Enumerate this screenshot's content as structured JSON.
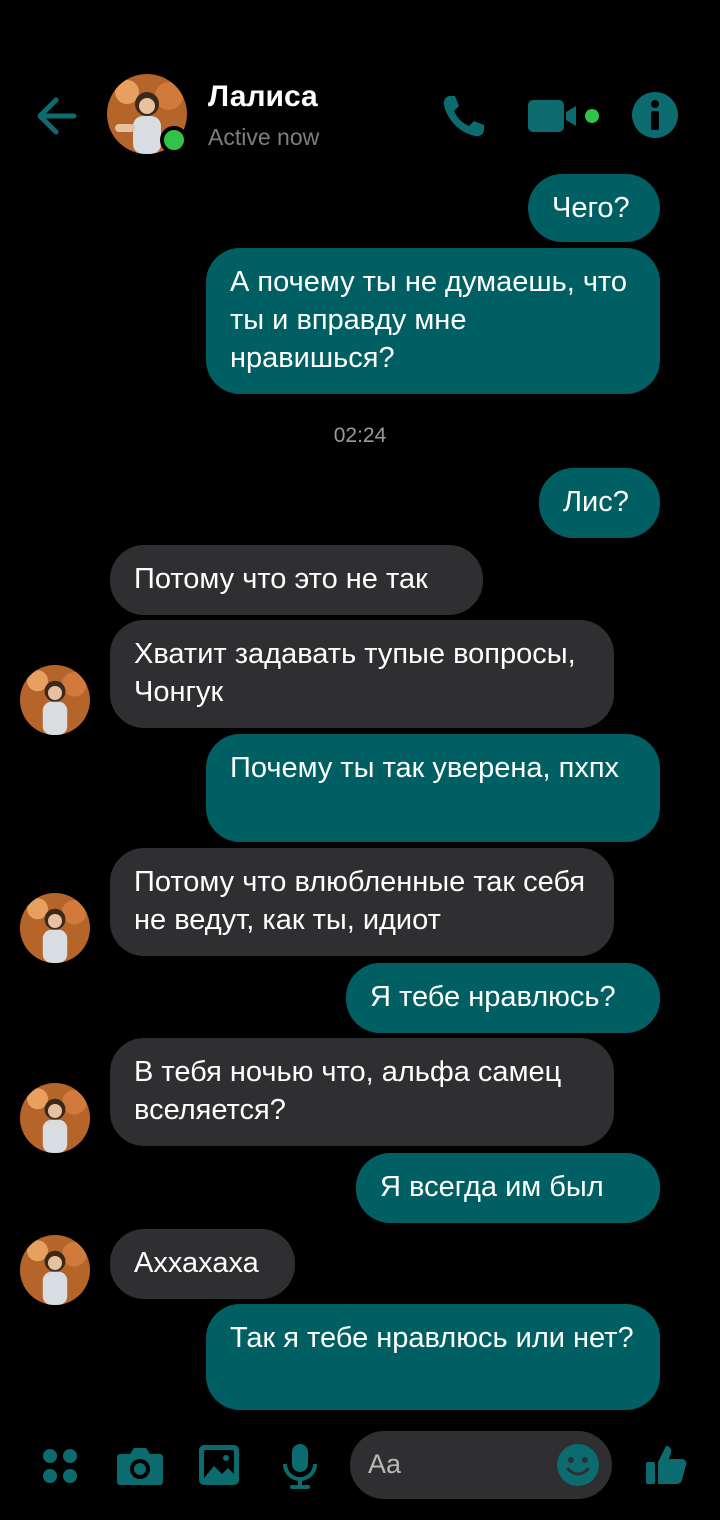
{
  "header": {
    "contact_name": "Лалиса",
    "status": "Active now",
    "icons": [
      "back-arrow-icon",
      "avatar",
      "phone-icon",
      "video-icon",
      "info-icon"
    ]
  },
  "timestamp": "02:24",
  "messages": [
    {
      "dir": "out",
      "text": "Чего?"
    },
    {
      "dir": "out",
      "text": "А почему ты не думаешь, что ты и вправду мне нравишься?"
    },
    {
      "dir": "out",
      "text": "Лис?"
    },
    {
      "dir": "in",
      "text": "Потому что это не так"
    },
    {
      "dir": "in",
      "text": "Хватит задавать тупые вопросы, Чонгук"
    },
    {
      "dir": "out",
      "text": "Почему ты так уверена, пхпх"
    },
    {
      "dir": "in",
      "text": "Потому что влюбленные так себя не ведут, как ты, идиот"
    },
    {
      "dir": "out",
      "text": "Я тебе нравлюсь?"
    },
    {
      "dir": "in",
      "text": "В тебя ночью что, альфа самец вселяется?"
    },
    {
      "dir": "out",
      "text": "Я всегда им был"
    },
    {
      "dir": "in",
      "text": "Аххахаха"
    },
    {
      "dir": "out",
      "text": "Так я тебе нравлюсь или нет?"
    }
  ],
  "composer": {
    "placeholder": "Aa",
    "icons": [
      "apps-icon",
      "camera-icon",
      "image-icon",
      "microphone-icon",
      "emoji-icon",
      "thumbs-up-icon"
    ]
  },
  "colors": {
    "accent": "#005f62",
    "incoming_bubble": "#2f2e31",
    "online": "#31c248",
    "background": "#000000"
  }
}
